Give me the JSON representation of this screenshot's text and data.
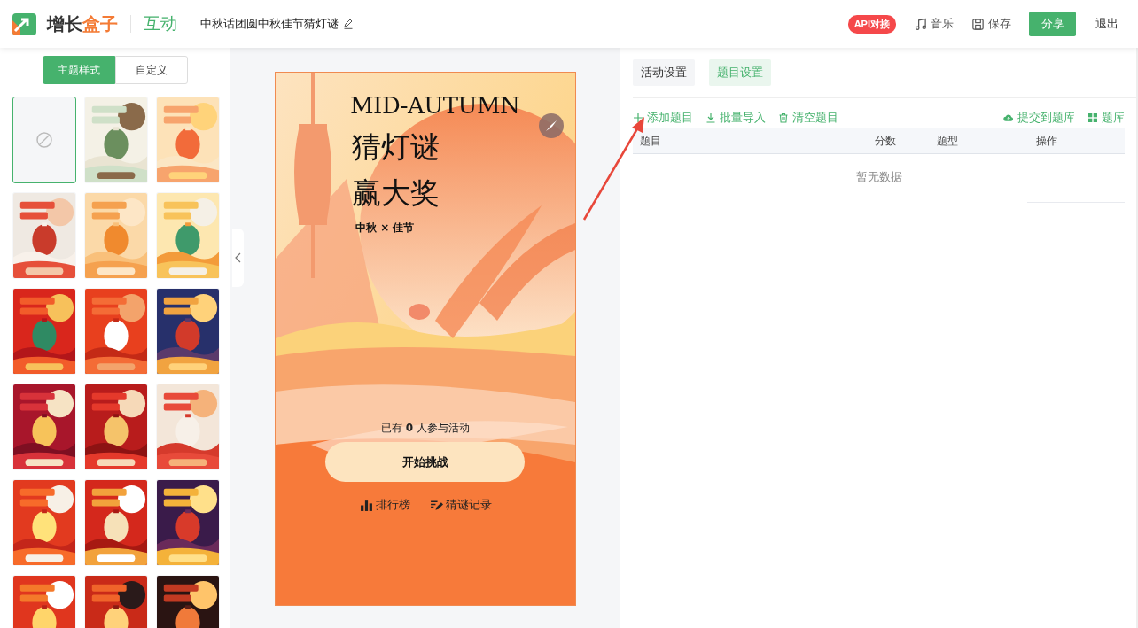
{
  "header": {
    "brand": [
      "增长",
      "盒子"
    ],
    "module": "互动",
    "title": "中秋话团圆中秋佳节猜灯谜",
    "api_badge": "API对接",
    "actions": [
      {
        "kind": "music",
        "label": "音乐"
      },
      {
        "kind": "save",
        "label": "保存"
      }
    ],
    "share": "分享",
    "exit": "退出"
  },
  "theme_tabs": [
    {
      "label": "主题样式",
      "selected": true
    },
    {
      "label": "自定义",
      "selected": false
    }
  ],
  "themes": [
    {
      "kind": "none",
      "selected": true
    },
    {
      "kind": "picture",
      "selected": false
    },
    {
      "kind": "picture",
      "selected": false
    },
    {
      "kind": "picture",
      "selected": false
    },
    {
      "kind": "picture",
      "selected": false
    },
    {
      "kind": "picture",
      "selected": false
    },
    {
      "kind": "picture",
      "selected": false
    },
    {
      "kind": "picture",
      "selected": false
    },
    {
      "kind": "picture",
      "selected": false
    },
    {
      "kind": "picture",
      "selected": false
    },
    {
      "kind": "picture",
      "selected": false
    },
    {
      "kind": "picture",
      "selected": false
    },
    {
      "kind": "picture",
      "selected": false
    },
    {
      "kind": "picture",
      "selected": false
    },
    {
      "kind": "picture",
      "selected": false
    },
    {
      "kind": "picture",
      "selected": false
    },
    {
      "kind": "picture",
      "selected": false
    },
    {
      "kind": "picture",
      "selected": false
    }
  ],
  "preview": {
    "headline": "MID-AUTUMN",
    "title_lines": [
      "猜灯谜",
      "赢大奖"
    ],
    "subtitle": "中秋 × 佳节",
    "participants": "已有 **0** 人参与活动",
    "start_button": "开始挑战",
    "links": [
      {
        "kind": "ranking",
        "label": "排行榜"
      },
      {
        "kind": "records",
        "label": "猜谜记录"
      }
    ]
  },
  "settings_tabs": [
    {
      "label": "活动设置",
      "selected": false
    },
    {
      "label": "题目设置",
      "selected": true
    }
  ],
  "toolbar": {
    "left": [
      {
        "kind": "add",
        "label": "添加题目"
      },
      {
        "kind": "import",
        "label": "批量导入"
      },
      {
        "kind": "clear",
        "label": "清空题目"
      }
    ],
    "right": [
      {
        "kind": "upload",
        "label": "提交到题库"
      },
      {
        "kind": "grid",
        "label": "题库"
      }
    ]
  },
  "table": {
    "columns": [
      "题目",
      "分数",
      "题型",
      "操作"
    ],
    "empty_text": "暂无数据"
  }
}
